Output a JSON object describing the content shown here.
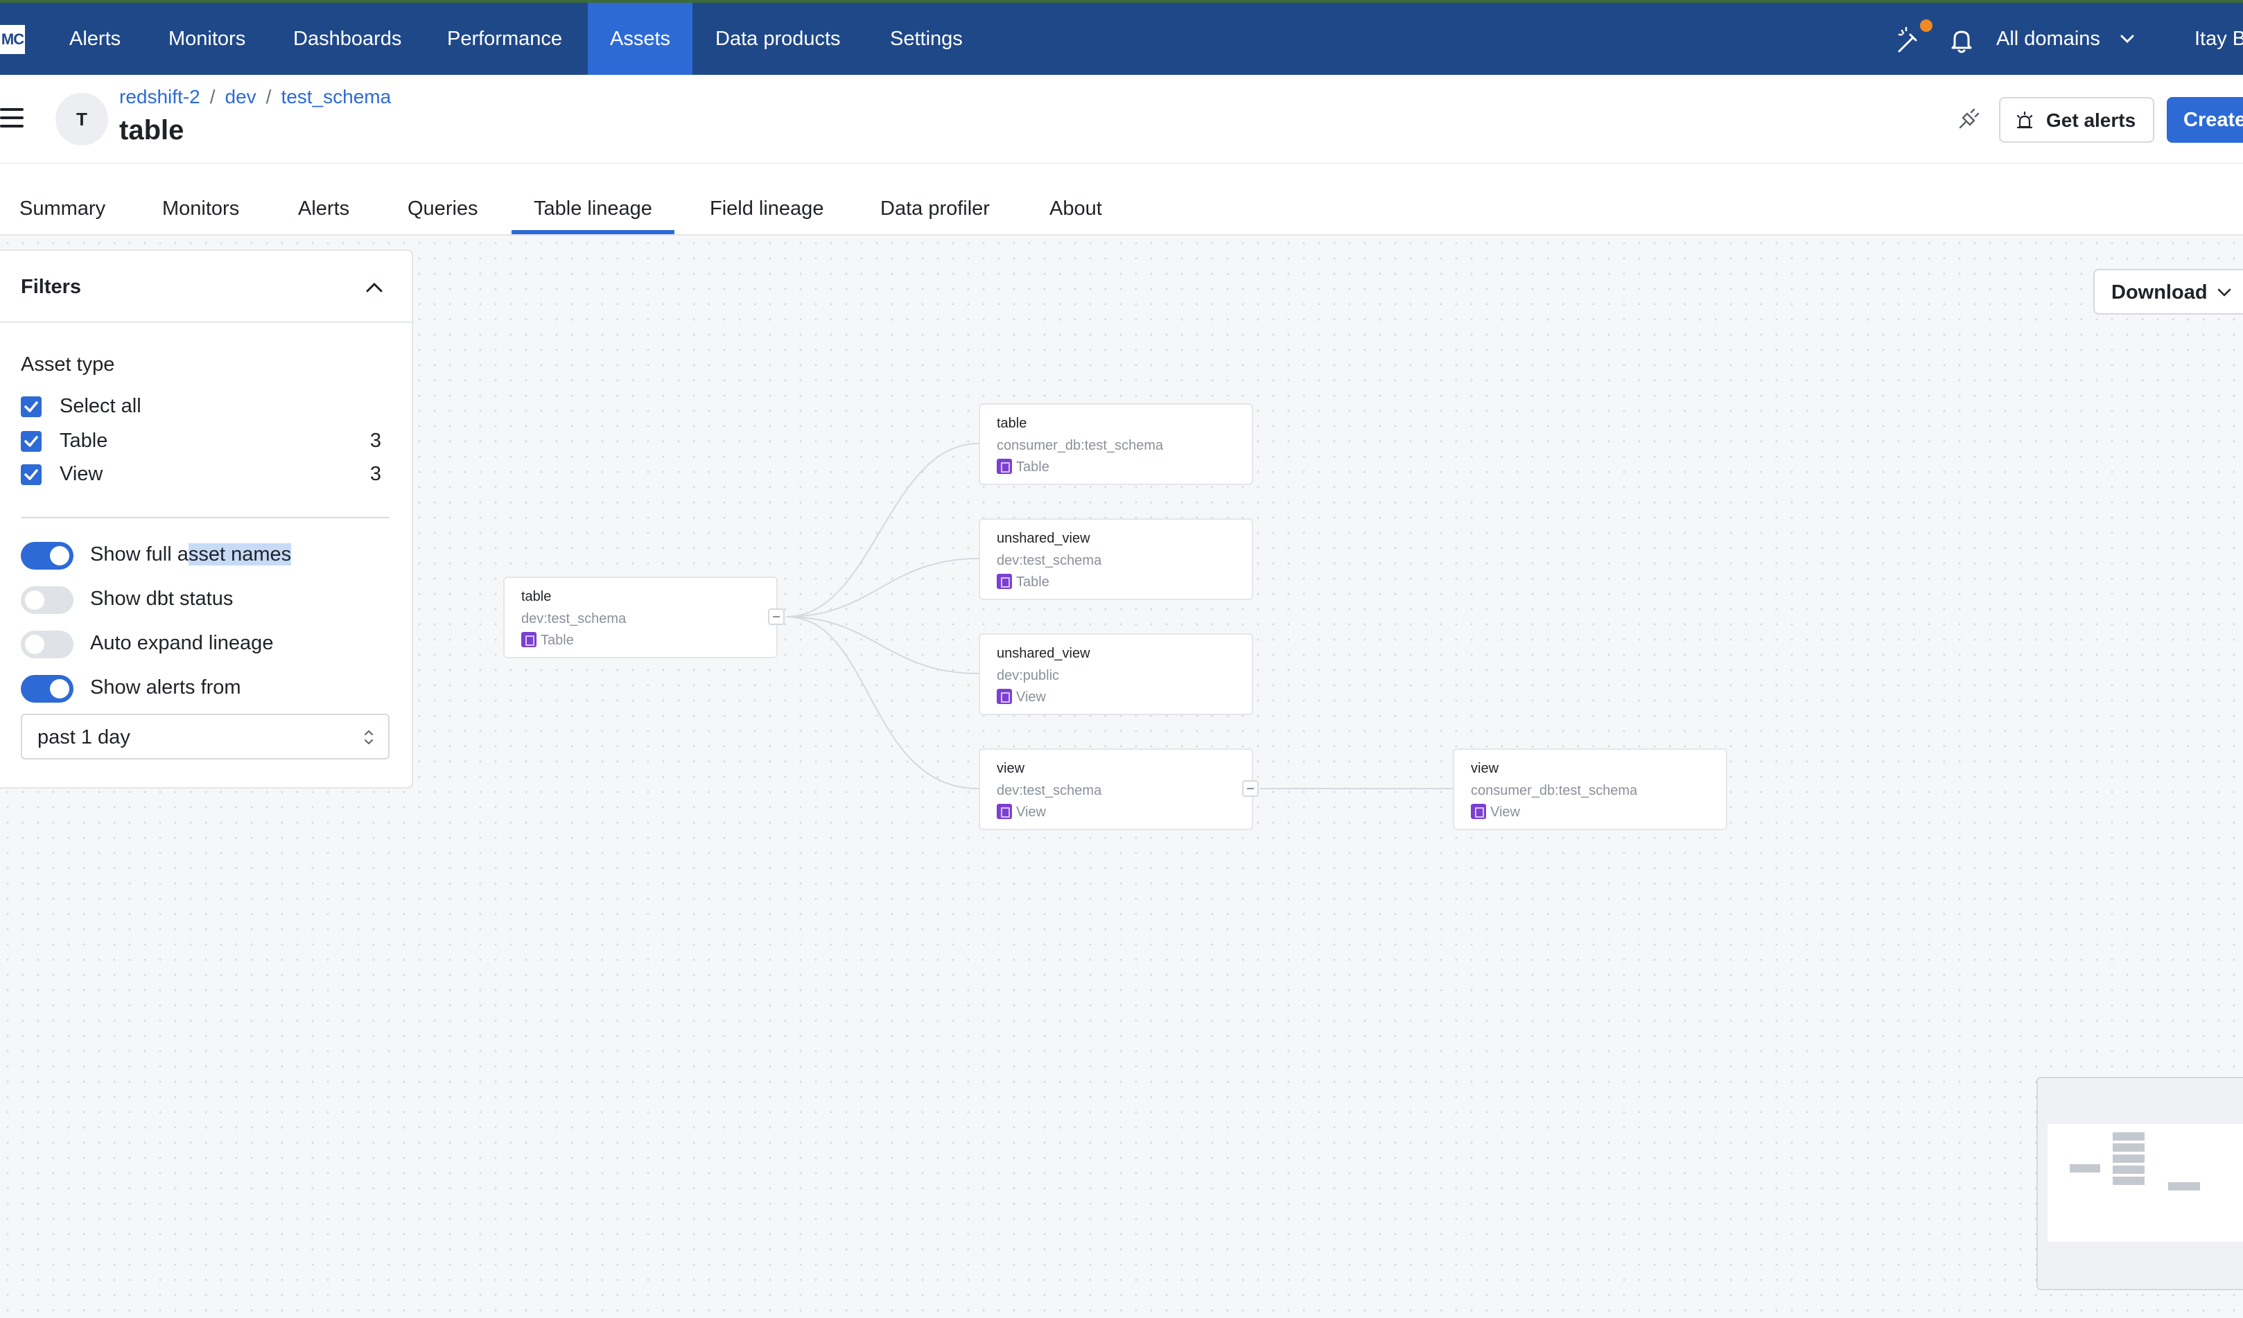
{
  "nav": {
    "logo": "MC",
    "items": [
      "Alerts",
      "Monitors",
      "Dashboards",
      "Performance",
      "Assets",
      "Data products",
      "Settings"
    ],
    "active": "Assets",
    "domains": "All domains",
    "user": "Itay B"
  },
  "header": {
    "avatar_letter": "T",
    "breadcrumb": [
      "redshift-2",
      "dev",
      "test_schema"
    ],
    "title": "table",
    "get_alerts_label": "Get alerts",
    "create_label": "Create"
  },
  "tabs": {
    "items": [
      "Summary",
      "Monitors",
      "Alerts",
      "Queries",
      "Table lineage",
      "Field lineage",
      "Data profiler",
      "About"
    ],
    "active": "Table lineage"
  },
  "filters": {
    "title": "Filters",
    "asset_type_label": "Asset type",
    "checkboxes": [
      {
        "label": "Select all",
        "count": "",
        "checked": true
      },
      {
        "label": "Table",
        "count": "3",
        "checked": true
      },
      {
        "label": "View",
        "count": "3",
        "checked": true
      }
    ],
    "toggles": [
      {
        "label_a": "Show full a",
        "label_b": "sset names",
        "on": true
      },
      {
        "label_a": "Show dbt status",
        "label_b": "",
        "on": false
      },
      {
        "label_a": "Auto expand lineage",
        "label_b": "",
        "on": false
      },
      {
        "label_a": "Show alerts from",
        "label_b": "",
        "on": true
      }
    ],
    "alerts_range": "past 1 day"
  },
  "download_label": "Download",
  "lineage": {
    "nodes": [
      {
        "name": "table",
        "path": "dev:test_schema",
        "type": "Table"
      },
      {
        "name": "table",
        "path": "consumer_db:test_schema",
        "type": "Table"
      },
      {
        "name": "unshared_view",
        "path": "dev:test_schema",
        "type": "Table"
      },
      {
        "name": "unshared_view",
        "path": "dev:public",
        "type": "View"
      },
      {
        "name": "view",
        "path": "dev:test_schema",
        "type": "View"
      },
      {
        "name": "view",
        "path": "consumer_db:test_schema",
        "type": "View"
      }
    ]
  },
  "colors": {
    "nav_bg": "#1f4889",
    "accent": "#2d6ad6",
    "asset_icon": "#7b3fd1",
    "notification": "#f08a24"
  }
}
